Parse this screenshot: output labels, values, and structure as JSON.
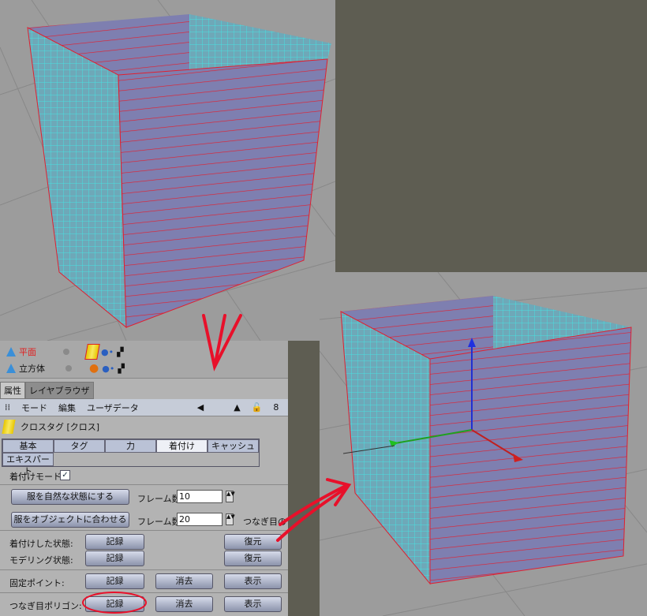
{
  "objects": [
    {
      "name": "平面",
      "color": "#e02020"
    },
    {
      "name": "立方体",
      "color": "#111111"
    }
  ],
  "tabs": [
    "属性",
    "レイヤブラウザ"
  ],
  "menu": [
    "モード",
    "編集",
    "ユーザデータ"
  ],
  "tag_title": "クロスタグ [クロス]",
  "subtabs": [
    "基本",
    "タグ",
    "力",
    "着付け",
    "キャッシュ",
    "エキスパート"
  ],
  "active_subtab": "着付け",
  "dress_mode": {
    "label": "着付けモード",
    "checked": true
  },
  "relax_button": "服を自然な状態にする",
  "fit_button": "服をオブジェクトに合わせる",
  "frames_label": "フレーム数",
  "frames1": "10",
  "frames2": "20",
  "seam_cut": "つなぎ目の",
  "rows": [
    {
      "label": "着付けした状態:",
      "record": "記録",
      "restore": "復元"
    },
    {
      "label": "モデリング状態:",
      "record": "記録",
      "restore": "復元"
    },
    {
      "label": "固定ポイント:",
      "record": "記録",
      "clear": "消去",
      "show": "表示"
    },
    {
      "label": "つなぎ目ポリゴン:",
      "record": "記録",
      "clear": "消去",
      "show": "表示"
    }
  ],
  "colors": {
    "cloth_face": "#7e7fb0",
    "mesh": "#48e0e0",
    "edge": "#e02030",
    "annotation": "#e8102a"
  }
}
